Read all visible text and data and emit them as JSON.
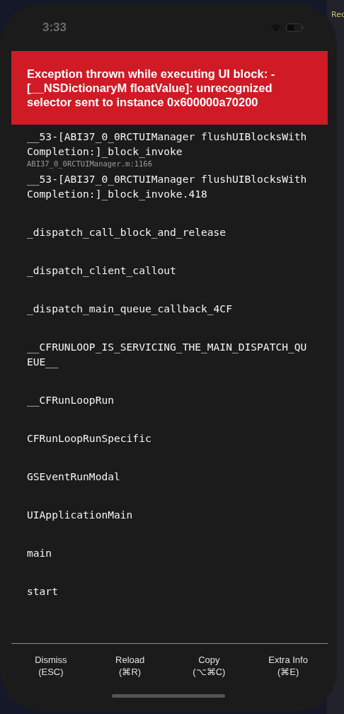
{
  "status_bar": {
    "time": "3:33"
  },
  "background_editor": {
    "text": "Rec"
  },
  "error_banner": {
    "message": "Exception thrown while executing UI block: -[__NSDictionaryM floatValue]: unrecognized selector sent to instance 0x600000a70200"
  },
  "stack_frames": [
    {
      "method": "__53-[ABI37_0_0RCTUIManager flushUIBlocksWithCompletion:]_block_invoke",
      "file": "ABI37_0_0RCTUIManager.m:1166"
    },
    {
      "method": "__53-[ABI37_0_0RCTUIManager flushUIBlocksWithCompletion:]_block_invoke.418"
    },
    {
      "method": "_dispatch_call_block_and_release"
    },
    {
      "method": "_dispatch_client_callout"
    },
    {
      "method": "_dispatch_main_queue_callback_4CF"
    },
    {
      "method": "__CFRUNLOOP_IS_SERVICING_THE_MAIN_DISPATCH_QUEUE__"
    },
    {
      "method": "__CFRunLoopRun"
    },
    {
      "method": "CFRunLoopRunSpecific"
    },
    {
      "method": "GSEventRunModal"
    },
    {
      "method": "UIApplicationMain"
    },
    {
      "method": "main"
    },
    {
      "method": "start"
    }
  ],
  "footer_buttons": [
    {
      "label": "Dismiss",
      "shortcut": "(ESC)"
    },
    {
      "label": "Reload",
      "shortcut": "(⌘R)"
    },
    {
      "label": "Copy",
      "shortcut": "(⌥⌘C)"
    },
    {
      "label": "Extra Info",
      "shortcut": "(⌘E)"
    }
  ]
}
